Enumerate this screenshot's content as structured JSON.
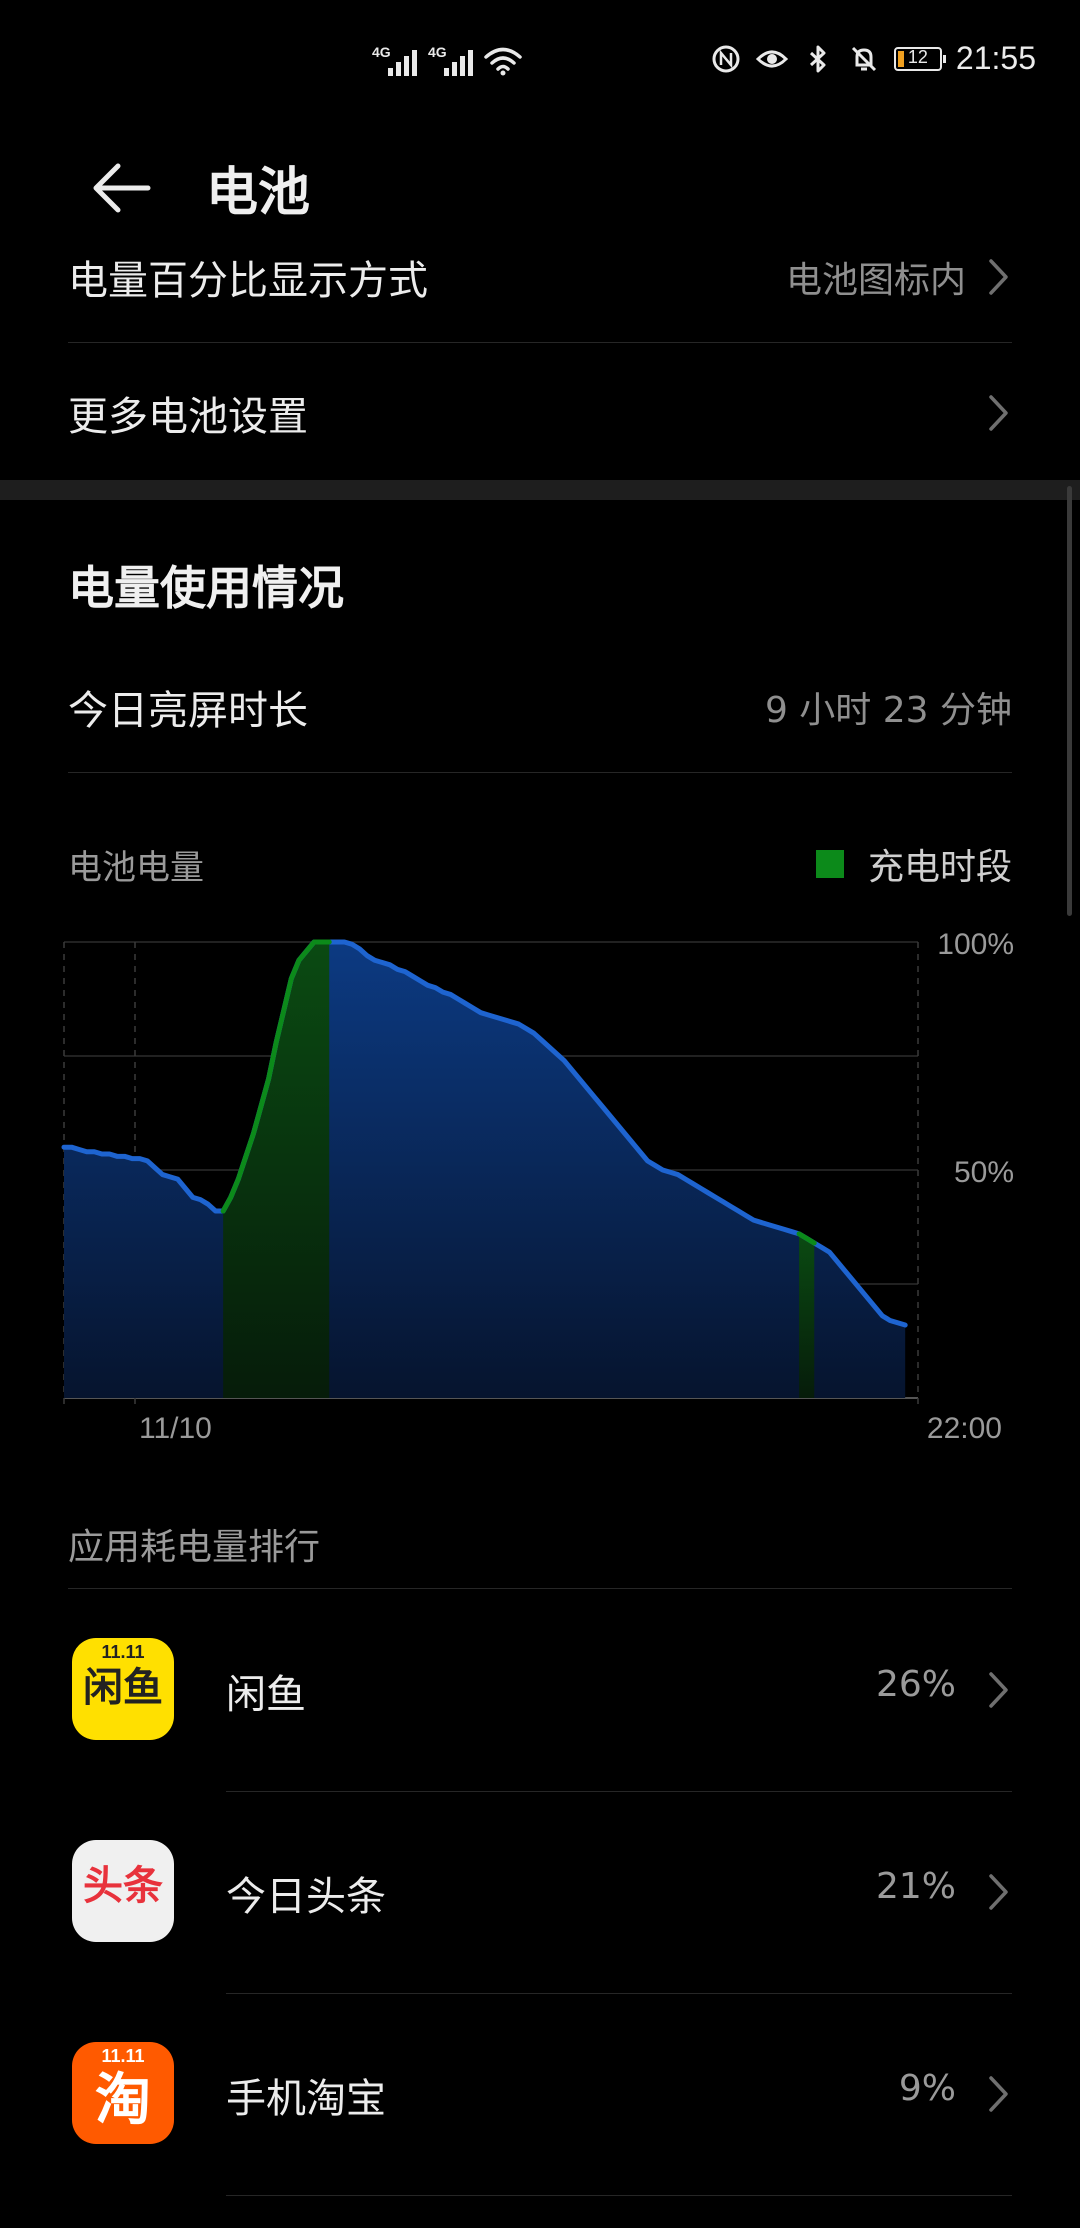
{
  "status_bar": {
    "network_tag_1": "4G",
    "network_tag_2": "4G",
    "battery_level": "12",
    "time": "21:55",
    "icons": [
      "signal-icon",
      "signal-icon",
      "wifi-icon",
      "nfc-icon",
      "eye-icon",
      "bluetooth-icon",
      "mute-icon",
      "battery-icon"
    ]
  },
  "header": {
    "title": "电池"
  },
  "settings": {
    "percent_display_label": "电量百分比显示方式",
    "percent_display_value": "电池图标内",
    "more_settings_label": "更多电池设置"
  },
  "usage": {
    "section_title": "电量使用情况",
    "screen_time_label": "今日亮屏时长",
    "screen_time_value": "9 小时 23 分钟"
  },
  "chart_data": {
    "type": "area",
    "title": "电池电量",
    "legend": [
      {
        "name": "充电时段",
        "color": "#0c8a1a"
      }
    ],
    "series_color": "#1e64d0",
    "charging_color": "#0c8a1a",
    "x_tick_labels": [
      "11/10",
      "22:00"
    ],
    "y_tick_labels": [
      "100%",
      "50%"
    ],
    "ylim": [
      0,
      100
    ],
    "grid": true,
    "values": [
      55,
      55,
      54.5,
      54,
      54,
      53.5,
      53.5,
      53,
      53,
      52.5,
      52.5,
      52,
      50.5,
      49,
      48.5,
      48,
      46,
      44,
      43.5,
      42.5,
      41,
      41,
      44,
      48,
      53,
      58,
      64,
      70,
      78,
      85,
      92,
      96,
      98,
      100,
      100,
      100,
      100,
      100,
      99.5,
      98.5,
      97,
      96,
      95.5,
      95,
      94,
      93.5,
      92.5,
      91.5,
      90.5,
      90,
      89,
      88.5,
      87.5,
      86.5,
      85.5,
      84.5,
      84,
      83.5,
      83,
      82.5,
      82,
      81,
      80,
      78.5,
      77,
      75.5,
      74,
      72,
      70,
      68,
      66,
      64,
      62,
      60,
      58,
      56,
      54,
      52,
      51,
      50,
      49.5,
      49,
      48,
      47,
      46,
      45,
      44,
      43,
      42,
      41,
      40,
      39,
      38.5,
      38,
      37.5,
      37,
      36.5,
      36,
      35,
      34,
      33,
      32,
      30,
      28,
      26,
      24,
      22,
      20,
      18,
      17,
      16.5,
      16
    ],
    "charging_ranges": [
      [
        21,
        35
      ],
      [
        97,
        99
      ]
    ]
  },
  "ranking": {
    "title": "应用耗电量排行",
    "apps": [
      {
        "name": "闲鱼",
        "percent": "26%",
        "icon_text": "闲鱼",
        "icon_badge": "11.11",
        "icon_bg": "#ffe000",
        "icon_fg": "#222222"
      },
      {
        "name": "今日头条",
        "percent": "21%",
        "icon_text": "头条",
        "icon_badge": "",
        "icon_bg": "#f0f0f0",
        "icon_fg": "#e8323c"
      },
      {
        "name": "手机淘宝",
        "percent": "9%",
        "icon_text": "淘",
        "icon_badge": "11.11",
        "icon_bg": "#ff5a00",
        "icon_fg": "#ffffff"
      }
    ]
  }
}
